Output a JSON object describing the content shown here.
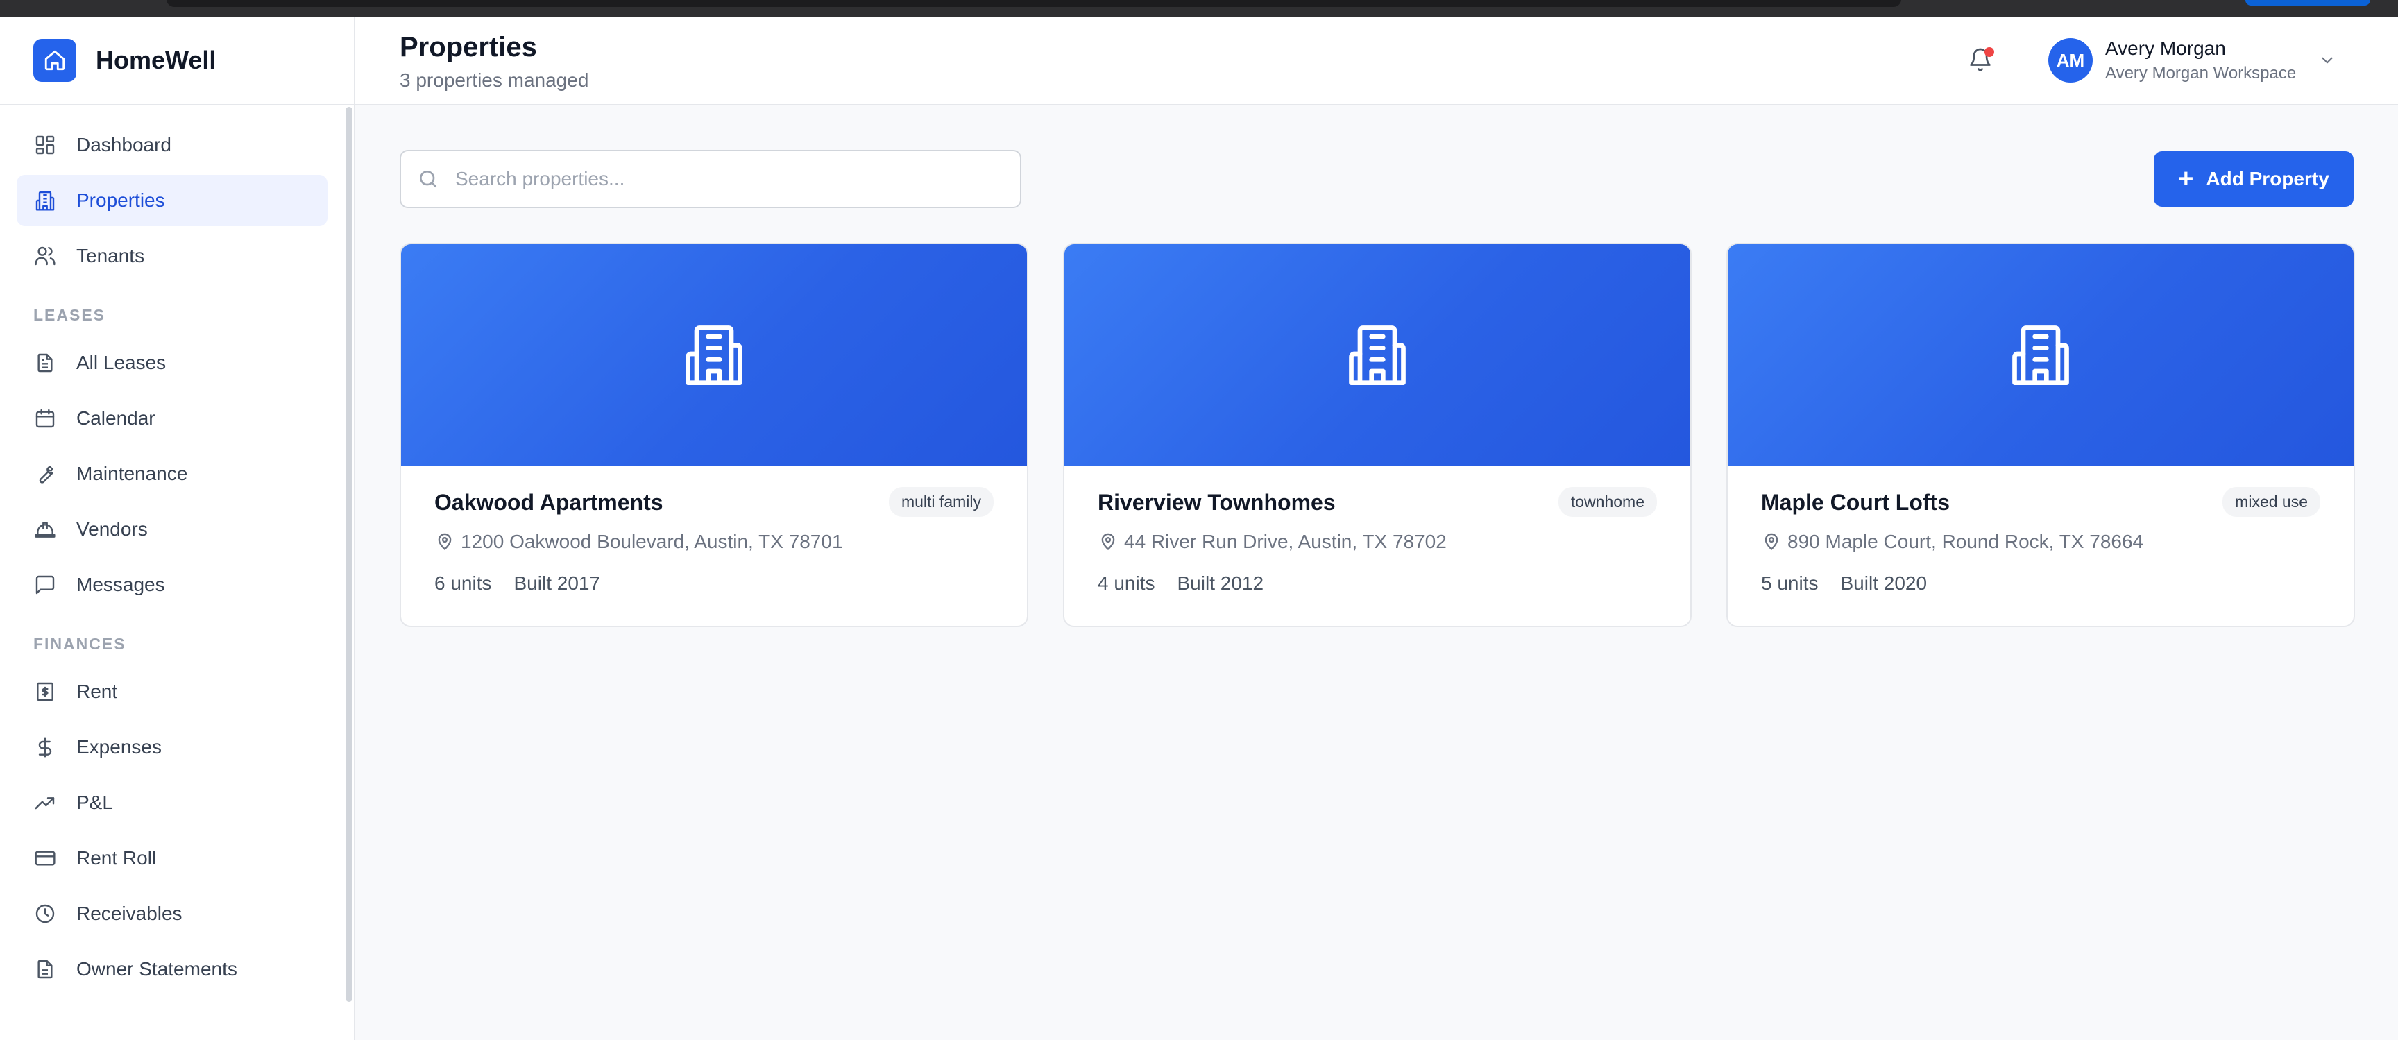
{
  "app": {
    "name": "HomeWell"
  },
  "sidebar": {
    "items": [
      {
        "label": "Dashboard",
        "icon": "dashboard-icon"
      },
      {
        "label": "Properties",
        "icon": "building-icon",
        "active": true
      },
      {
        "label": "Tenants",
        "icon": "users-icon"
      }
    ],
    "sections": [
      {
        "title": "LEASES",
        "items": [
          {
            "label": "All Leases",
            "icon": "document-icon"
          },
          {
            "label": "Calendar",
            "icon": "calendar-icon"
          },
          {
            "label": "Maintenance",
            "icon": "wrench-icon"
          },
          {
            "label": "Vendors",
            "icon": "hard-hat-icon"
          },
          {
            "label": "Messages",
            "icon": "message-icon"
          }
        ]
      },
      {
        "title": "FINANCES",
        "items": [
          {
            "label": "Rent",
            "icon": "receipt-dollar-icon"
          },
          {
            "label": "Expenses",
            "icon": "dollar-icon"
          },
          {
            "label": "P&L",
            "icon": "trending-up-icon"
          },
          {
            "label": "Rent Roll",
            "icon": "credit-card-icon"
          },
          {
            "label": "Receivables",
            "icon": "clock-icon"
          },
          {
            "label": "Owner Statements",
            "icon": "file-text-icon"
          }
        ]
      }
    ]
  },
  "header": {
    "title": "Properties",
    "subtitle": "3 properties managed",
    "user": {
      "initials": "AM",
      "name": "Avery Morgan",
      "workspace": "Avery Morgan Workspace"
    }
  },
  "search": {
    "placeholder": "Search properties...",
    "value": ""
  },
  "add_button": {
    "label": "Add Property"
  },
  "properties": [
    {
      "name": "Oakwood Apartments",
      "type": "multi family",
      "address": "1200 Oakwood Boulevard, Austin, TX 78701",
      "units": "6 units",
      "built": "Built 2017"
    },
    {
      "name": "Riverview Townhomes",
      "type": "townhome",
      "address": "44 River Run Drive, Austin, TX 78702",
      "units": "4 units",
      "built": "Built 2012"
    },
    {
      "name": "Maple Court Lofts",
      "type": "mixed use",
      "address": "890 Maple Court, Round Rock, TX 78664",
      "units": "5 units",
      "built": "Built 2020"
    }
  ],
  "colors": {
    "accent": "#2563eb",
    "notification": "#ef4444"
  }
}
